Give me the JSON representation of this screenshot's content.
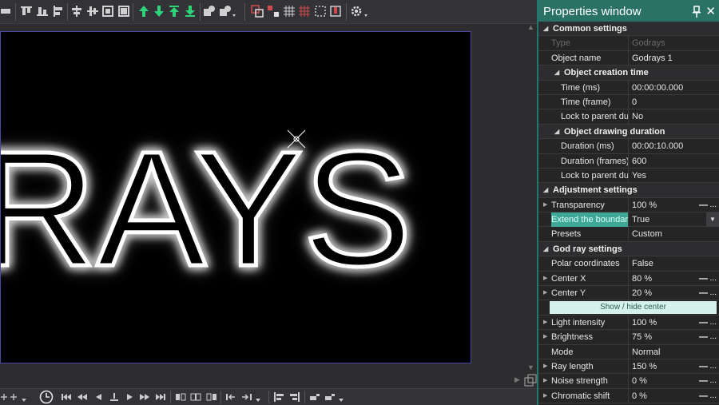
{
  "properties_window": {
    "title": "Properties window",
    "rows": [
      {
        "kind": "category",
        "level": 0,
        "label": "Common settings"
      },
      {
        "kind": "prop",
        "level": 0,
        "name": "Type",
        "value": "Godrays",
        "readonly": true
      },
      {
        "kind": "prop",
        "level": 0,
        "name": "Object name",
        "value": "Godrays 1"
      },
      {
        "kind": "category",
        "level": 1,
        "label": "Object creation time"
      },
      {
        "kind": "prop",
        "level": 1,
        "name": "Time (ms)",
        "value": "00:00:00.000"
      },
      {
        "kind": "prop",
        "level": 1,
        "name": "Time (frame)",
        "value": "0"
      },
      {
        "kind": "prop",
        "level": 1,
        "name": "Lock to parent du",
        "value": "No"
      },
      {
        "kind": "category",
        "level": 1,
        "label": "Object drawing duration"
      },
      {
        "kind": "prop",
        "level": 1,
        "name": "Duration (ms)",
        "value": "00:00:10.000"
      },
      {
        "kind": "prop",
        "level": 1,
        "name": "Duration (frames)",
        "value": "600"
      },
      {
        "kind": "prop",
        "level": 1,
        "name": "Lock to parent du",
        "value": "Yes"
      },
      {
        "kind": "category",
        "level": 0,
        "label": "Adjustment settings"
      },
      {
        "kind": "prop",
        "level": 0,
        "name": "Transparency",
        "value": "100 %",
        "expander": true,
        "slider": true
      },
      {
        "kind": "prop",
        "level": 0,
        "name": "Extend the boundari",
        "value": "True",
        "selected": true,
        "dropdown": true
      },
      {
        "kind": "prop",
        "level": 0,
        "name": "Presets",
        "value": "Custom"
      },
      {
        "kind": "category",
        "level": 0,
        "label": "God ray settings"
      },
      {
        "kind": "prop",
        "level": 0,
        "name": "Polar coordinates",
        "value": "False"
      },
      {
        "kind": "prop",
        "level": 0,
        "name": "Center X",
        "value": "80 %",
        "expander": true,
        "slider": true
      },
      {
        "kind": "prop",
        "level": 0,
        "name": "Center Y",
        "value": "20 %",
        "expander": true,
        "slider": true
      },
      {
        "kind": "button",
        "label": "Show / hide center"
      },
      {
        "kind": "prop",
        "level": 0,
        "name": "Light intensity",
        "value": "100 %",
        "expander": true,
        "slider": true
      },
      {
        "kind": "prop",
        "level": 0,
        "name": "Brightness",
        "value": "75 %",
        "expander": true,
        "slider": true
      },
      {
        "kind": "prop",
        "level": 0,
        "name": "Mode",
        "value": "Normal"
      },
      {
        "kind": "prop",
        "level": 0,
        "name": "Ray length",
        "value": "150 %",
        "expander": true,
        "slider": true
      },
      {
        "kind": "prop",
        "level": 0,
        "name": "Noise strength",
        "value": "0 %",
        "expander": true,
        "slider": true
      },
      {
        "kind": "prop",
        "level": 0,
        "name": "Chromatic shift",
        "value": "0 %",
        "expander": true,
        "slider": true
      }
    ]
  },
  "canvas": {
    "preview_text": "RAYS"
  },
  "top_toolbar": {
    "icons": [
      "align-icon",
      "align-top-icon",
      "align-bottom-icon",
      "align-left-icon",
      "center-horizontal-icon",
      "center-vertical-icon",
      "fit-icon",
      "fill-icon",
      "move-up-icon",
      "move-down-icon",
      "move-to-top-icon",
      "move-to-bottom-icon",
      "group-icon",
      "shape-icon",
      "select-all-icon",
      "deselect-icon",
      "grid-icon",
      "snap-icon",
      "crop-icon",
      "marker-icon",
      "settings-icon"
    ]
  },
  "bottom_toolbar": {
    "icons": [
      "add-icon",
      "clock-icon",
      "skip-start-icon",
      "rewind-icon",
      "step-back-icon",
      "stop-icon",
      "play-icon",
      "fast-forward-icon",
      "skip-end-icon",
      "split-icon",
      "split-2-icon",
      "split-3-icon",
      "go-start-icon",
      "go-end-icon",
      "align-left-icon",
      "align-right-icon",
      "snap-left-icon",
      "snap-right-icon"
    ]
  }
}
